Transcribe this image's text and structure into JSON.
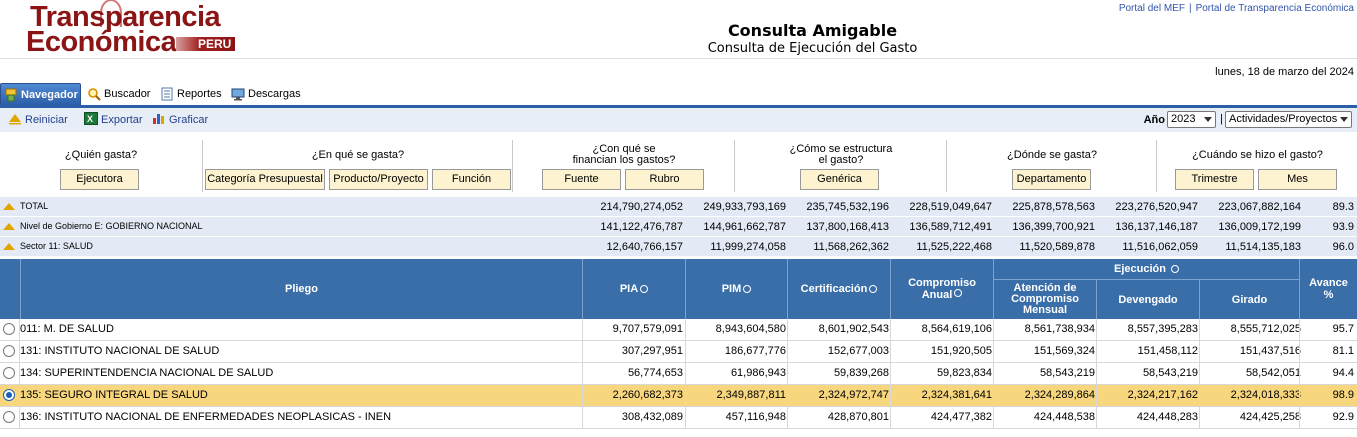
{
  "brand": {
    "line1": "Transparencia",
    "line2": "Económica",
    "country": "PERU"
  },
  "header": {
    "title": "Consulta Amigable",
    "subtitle": "Consulta de Ejecución del Gasto"
  },
  "toplinks": {
    "mef": "Portal del MEF",
    "sep": "|",
    "transparency": "Portal de Transparencia Económica"
  },
  "date": "lunes, 18 de marzo del 2024",
  "tabs": [
    {
      "label": "Navegador",
      "icon": "navigator-icon",
      "active": true
    },
    {
      "label": "Buscador",
      "icon": "magnifier-icon",
      "active": false
    },
    {
      "label": "Reportes",
      "icon": "report-icon",
      "active": false
    },
    {
      "label": "Descargas",
      "icon": "download-monitor-icon",
      "active": false
    }
  ],
  "toolbar": {
    "reset": "Reiniciar",
    "export": "Exportar",
    "chart": "Graficar",
    "year_label": "Año",
    "year_value": "2023",
    "pipe": "|",
    "type_value": "Actividades/Proyectos"
  },
  "questions": [
    {
      "text": "¿Quién gasta?",
      "buttons": [
        "Ejecutora"
      ]
    },
    {
      "text": "¿En qué se gasta?",
      "buttons": [
        "Categoría Presupuestal",
        "Producto/Proyecto",
        "Función"
      ]
    },
    {
      "text": "¿Con qué se financian los gastos?",
      "line1": "¿Con qué se",
      "line2": "financian los gastos?",
      "buttons": [
        "Fuente",
        "Rubro"
      ]
    },
    {
      "text": "¿Cómo se estructura el gasto?",
      "line1": "¿Cómo se estructura",
      "line2": "el gasto?",
      "buttons": [
        "Genérica"
      ]
    },
    {
      "text": "¿Dónde se gasta?",
      "buttons": [
        "Departamento"
      ]
    },
    {
      "text": "¿Cuándo se hizo el gasto?",
      "buttons": [
        "Trimestre",
        "Mes"
      ]
    }
  ],
  "summary": [
    {
      "label": "TOTAL",
      "values": [
        "214,790,274,052",
        "249,933,793,169",
        "235,745,532,196",
        "228,519,049,647",
        "225,878,578,563",
        "223,276,520,947",
        "223,067,882,164",
        "89.3"
      ]
    },
    {
      "label": "Nivel de Gobierno E: GOBIERNO NACIONAL",
      "values": [
        "141,122,476,787",
        "144,961,662,787",
        "137,800,168,413",
        "136,589,712,491",
        "136,399,700,921",
        "136,137,146,187",
        "136,009,172,199",
        "93.9"
      ]
    },
    {
      "label": "Sector 11: SALUD",
      "values": [
        "12,640,766,157",
        "11,999,274,058",
        "11,568,262,362",
        "11,525,222,468",
        "11,520,589,878",
        "11,516,062,059",
        "11,514,135,183",
        "96.0"
      ]
    }
  ],
  "table_header": {
    "pliego": "Pliego",
    "pia": "PIA",
    "pim": "PIM",
    "cert": "Certificación",
    "comp_l1": "Compromiso",
    "comp_l2": "Anual",
    "ejec": "Ejecución",
    "atcm_l1": "Atención de",
    "atcm_l2": "Compromiso",
    "atcm_l3": "Mensual",
    "dev": "Devengado",
    "gir": "Girado",
    "av_l1": "Avance",
    "av_l2": "%"
  },
  "rows": [
    {
      "name": "011: M. DE SALUD",
      "selected": false,
      "values": [
        "9,707,579,091",
        "8,943,604,580",
        "8,601,902,543",
        "8,564,619,106",
        "8,561,738,934",
        "8,557,395,283",
        "8,555,712,025",
        "95.7"
      ]
    },
    {
      "name": "131: INSTITUTO NACIONAL DE SALUD",
      "selected": false,
      "values": [
        "307,297,951",
        "186,677,776",
        "152,677,003",
        "151,920,505",
        "151,569,324",
        "151,458,112",
        "151,437,516",
        "81.1"
      ]
    },
    {
      "name": "134: SUPERINTENDENCIA NACIONAL DE SALUD",
      "selected": false,
      "values": [
        "56,774,653",
        "61,986,943",
        "59,839,268",
        "59,823,834",
        "58,543,219",
        "58,543,219",
        "58,542,051",
        "94.4"
      ]
    },
    {
      "name": "135: SEGURO INTEGRAL DE SALUD",
      "selected": true,
      "values": [
        "2,260,682,373",
        "2,349,887,811",
        "2,324,972,747",
        "2,324,381,641",
        "2,324,289,864",
        "2,324,217,162",
        "2,324,018,333",
        "98.9"
      ]
    },
    {
      "name": "136: INSTITUTO NACIONAL DE ENFERMEDADES NEOPLASICAS - INEN",
      "selected": false,
      "values": [
        "308,432,089",
        "457,116,948",
        "428,870,801",
        "424,477,382",
        "424,448,538",
        "424,448,283",
        "424,425,258",
        "92.9"
      ]
    }
  ],
  "colors": {
    "accent": "#3a6ea8",
    "brand": "#8b1414",
    "selected_row": "#f7d67e",
    "summary_bg": "#e4eaf5",
    "button_bg": "#fdf3d0"
  }
}
